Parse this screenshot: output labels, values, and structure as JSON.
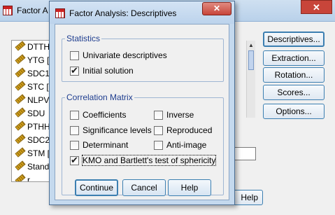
{
  "parent": {
    "title": "Factor A",
    "close_glyph": "✕",
    "variables": [
      "DTTH",
      "YTG [",
      "SDC1",
      "STC [",
      "NLPV",
      "SDU",
      "PTHH",
      "SDC2",
      "STM [",
      "Standa",
      "r"
    ],
    "side_buttons": [
      "Descriptives...",
      "Extraction...",
      "Rotation...",
      "Scores...",
      "Options..."
    ],
    "help_label": "Help",
    "scroll_up_glyph": "▲"
  },
  "dialog": {
    "title": "Factor Analysis: Descriptives",
    "close_glyph": "✕",
    "statistics": {
      "label": "Statistics",
      "univariate": "Univariate descriptives",
      "initial": "Initial solution"
    },
    "correlation": {
      "label": "Correlation Matrix",
      "coefficients": "Coefficients",
      "significance": "Significance levels",
      "determinant": "Determinant",
      "kmo": "KMO and Bartlett's test of sphericity",
      "inverse": "Inverse",
      "reproduced": "Reproduced",
      "anti_image": "Anti-image"
    },
    "checked": {
      "univariate": false,
      "initial": true,
      "coefficients": false,
      "significance": false,
      "determinant": false,
      "kmo": true,
      "inverse": false,
      "reproduced": false,
      "anti_image": false
    },
    "buttons": {
      "continue": "Continue",
      "cancel": "Cancel",
      "help": "Help"
    }
  },
  "colors": {
    "group_label": "#1e3d8f",
    "button_border": "#3c7fb1",
    "close_red": "#c8453a"
  }
}
